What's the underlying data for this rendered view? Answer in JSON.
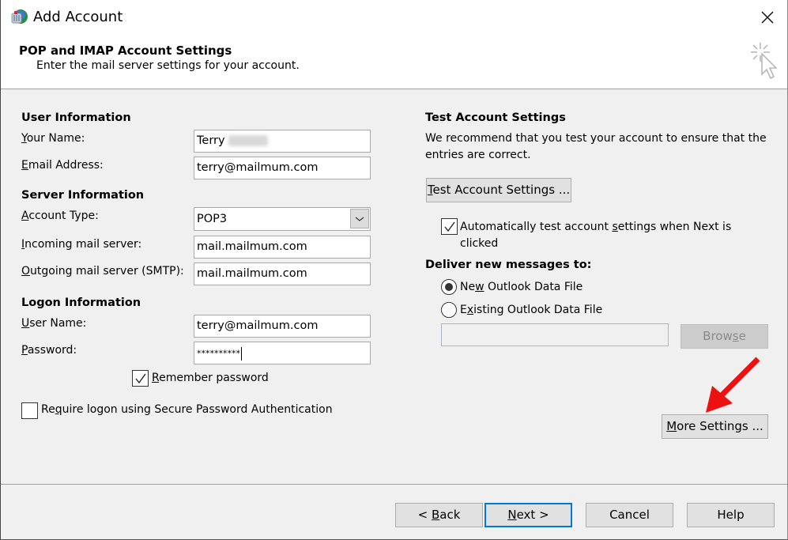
{
  "window": {
    "title": "Add Account",
    "app_icon": "outlook-account-icon",
    "close_icon": "close-icon"
  },
  "header": {
    "title": "POP and IMAP Account Settings",
    "subtitle": "Enter the mail server settings for your account.",
    "decor_icon": "sparkle-cursor-icon"
  },
  "user_info": {
    "heading": "User Information",
    "your_name_label_key": "Y",
    "your_name_label_rest": "our Name:",
    "your_name_value": "Terry",
    "email_label_key": "E",
    "email_label_rest": "mail Address:",
    "email_value": "terry@mailmum.com"
  },
  "server_info": {
    "heading": "Server Information",
    "account_type_label_key": "A",
    "account_type_label_rest": "ccount Type:",
    "account_type_value": "POP3",
    "incoming_label_key": "I",
    "incoming_label_rest": "ncoming mail server:",
    "incoming_value": "mail.mailmum.com",
    "outgoing_label_key": "O",
    "outgoing_label_rest": "utgoing mail server (SMTP):",
    "outgoing_value": "mail.mailmum.com"
  },
  "logon_info": {
    "heading": "Logon Information",
    "username_label_key": "U",
    "username_label_rest": "ser Name:",
    "username_value": "terry@mailmum.com",
    "password_label_key": "P",
    "password_label_rest": "assword:",
    "password_value": "**********",
    "remember_key": "R",
    "remember_rest": "emember password",
    "remember_checked": true,
    "spa_pre": "Re",
    "spa_key": "q",
    "spa_rest": "uire logon using Secure Password Authentication",
    "spa_checked": false
  },
  "test_settings": {
    "heading": "Test Account Settings",
    "description_line1": "We recommend that you test your account to ensure that the",
    "description_line2": "entries are correct.",
    "test_button_key": "T",
    "test_button_rest": "est Account Settings ...",
    "auto_test_pre": "Automatically test account ",
    "auto_test_key": "s",
    "auto_test_rest": "ettings when Next is",
    "auto_test_line2": "clicked",
    "auto_test_checked": true
  },
  "deliver": {
    "heading": "Deliver new messages to:",
    "new_file_pre": "Ne",
    "new_file_key": "w",
    "new_file_rest": " Outlook Data File",
    "new_file_selected": true,
    "existing_pre": "E",
    "existing_key": "x",
    "existing_rest": "isting Outlook Data File",
    "existing_selected": false,
    "path_value": "",
    "browse_pre": "Brow",
    "browse_key": "s",
    "browse_rest": "e"
  },
  "more_settings": {
    "key": "M",
    "rest": "ore Settings ..."
  },
  "annotation": {
    "arrow_color": "#ee1111"
  },
  "footer": {
    "back_pre": "< ",
    "back_key": "B",
    "back_rest": "ack",
    "next_key": "N",
    "next_rest": "ext >",
    "cancel": "Cancel",
    "help": "Help"
  }
}
